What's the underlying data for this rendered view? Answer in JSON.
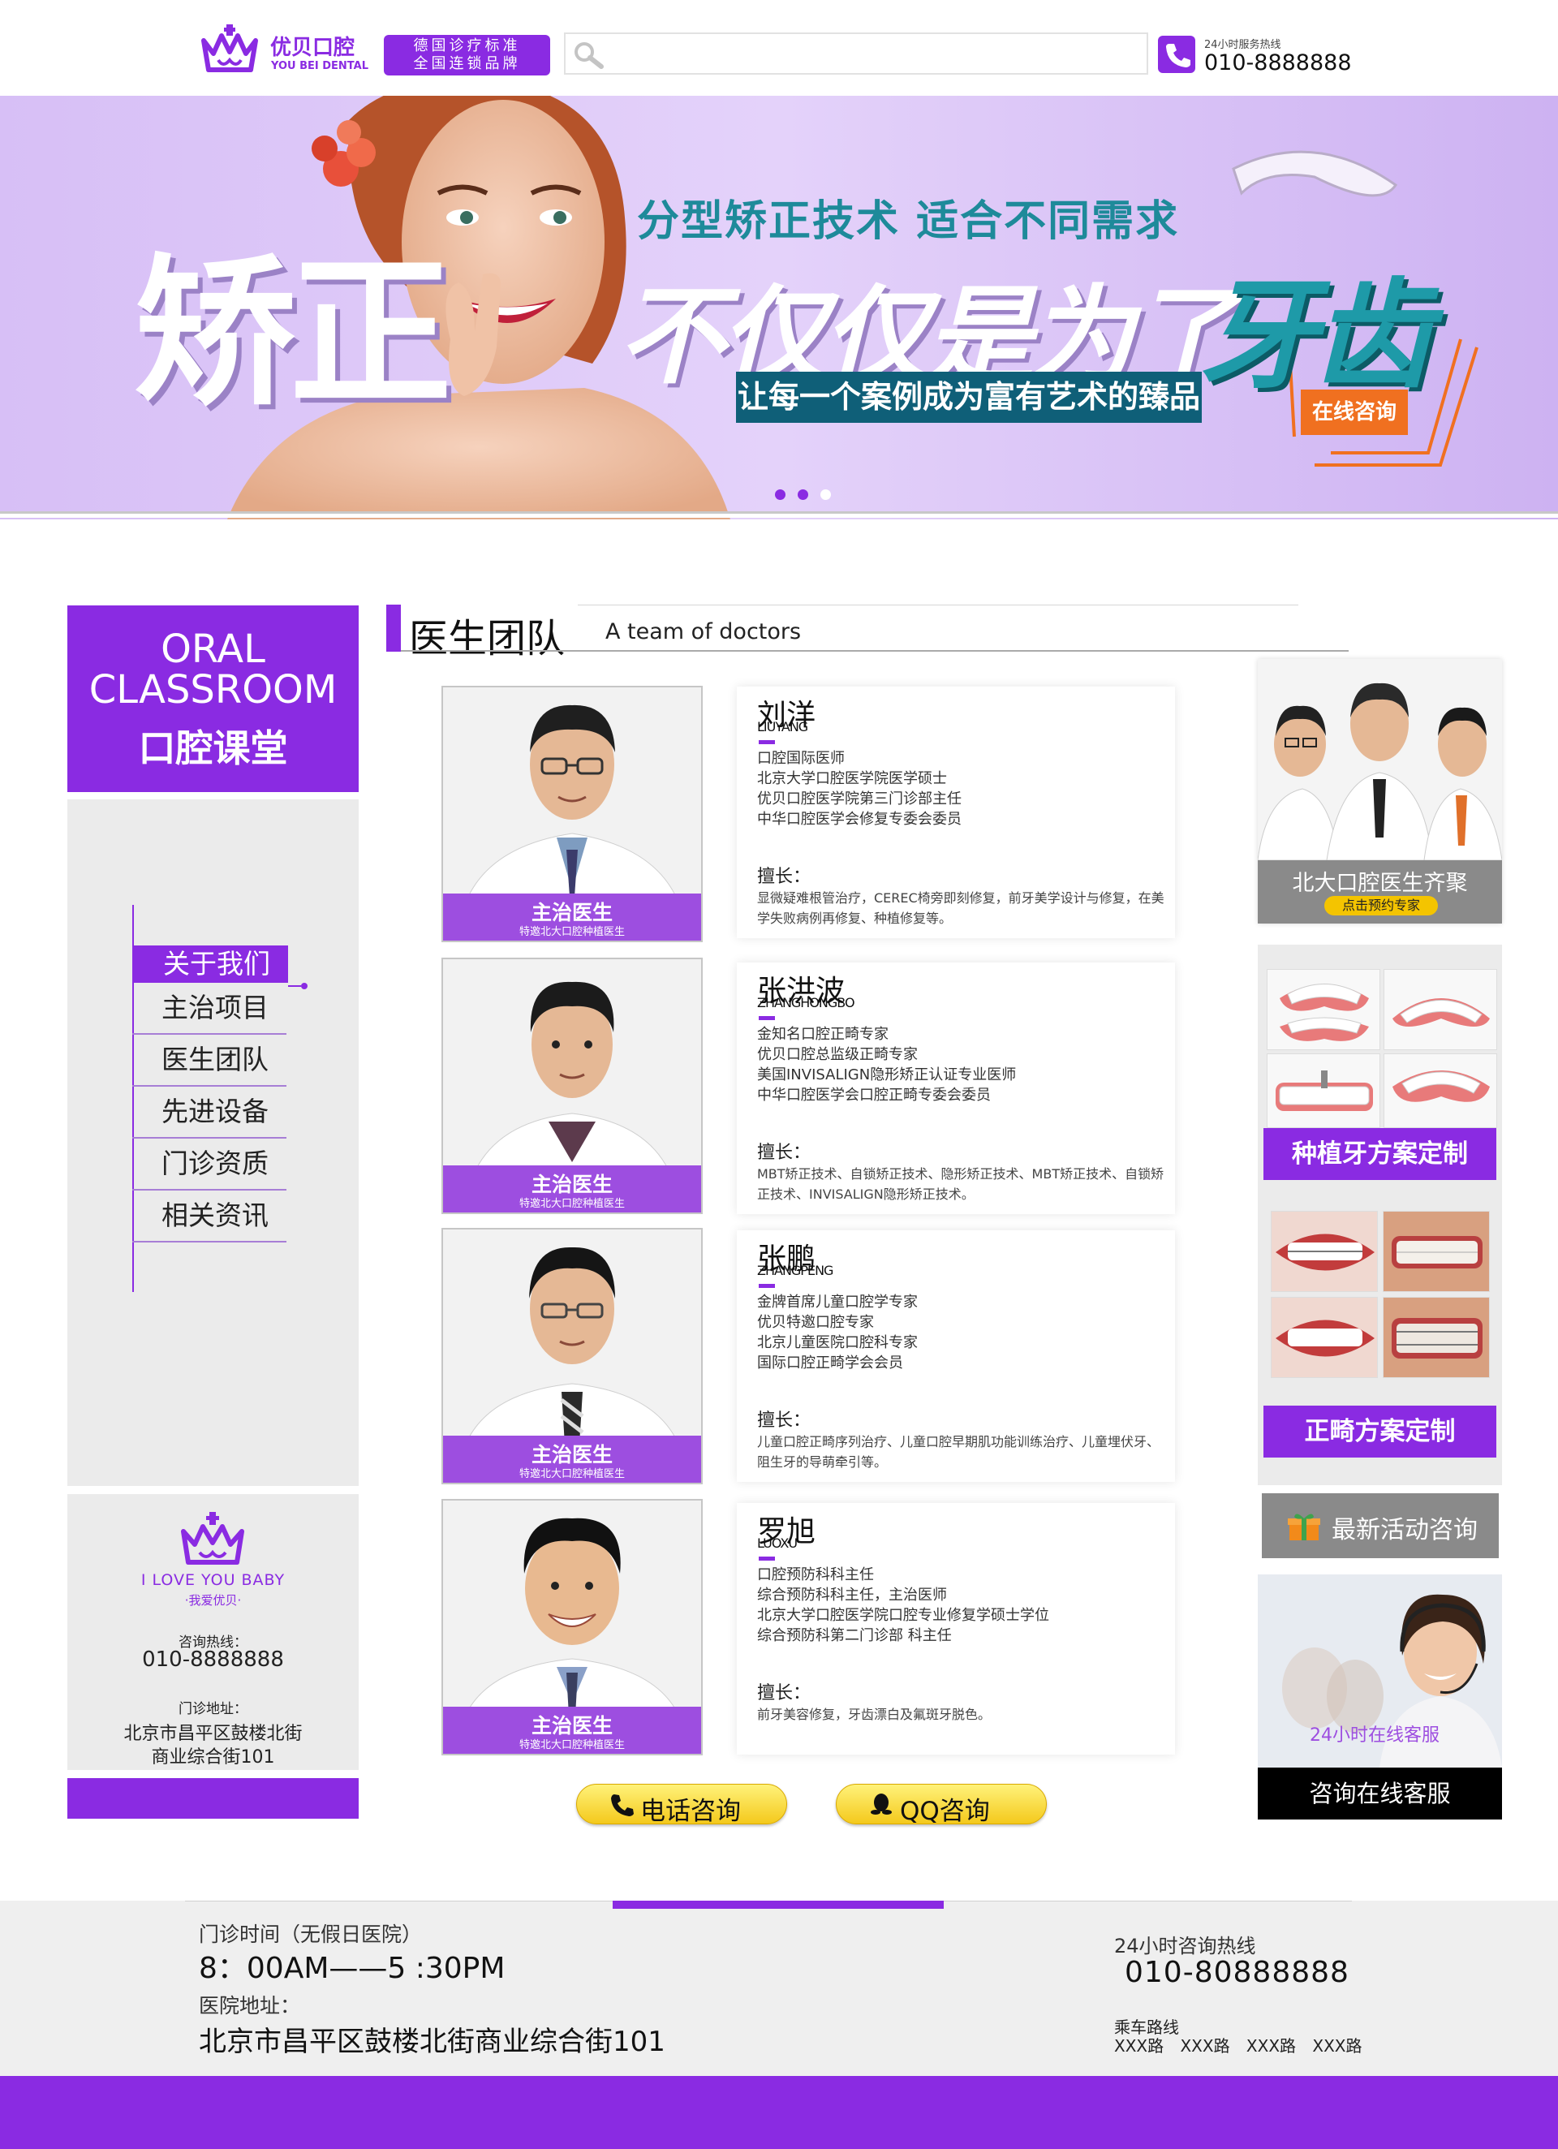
{
  "header": {
    "logo_cn": "优贝口腔",
    "logo_en": "YOU BEI DENTAL",
    "slogan_line1": "德国诊疗标准",
    "slogan_line2": "全国连锁品牌",
    "search_placeholder": "",
    "hotline_label": "24小时服务热线",
    "hotline_number": "010-8888888"
  },
  "banner": {
    "headline_left": "矫正",
    "subtitle": "分型矫正技术  适合不同需求",
    "headline_right": "不仅仅是为了",
    "headline_accent": "牙齿",
    "tagline": "让每一个案例成为富有艺术的臻品",
    "consult_button": "在线咨询",
    "slide_count": 3,
    "active_slide": 3
  },
  "sidebar": {
    "classroom_en_1": "ORAL",
    "classroom_en_2": "CLASSROOM",
    "classroom_cn": "口腔课堂",
    "nav": [
      {
        "label": "关于我们",
        "active": true
      },
      {
        "label": "主治项目",
        "active": false
      },
      {
        "label": "医生团队",
        "active": false
      },
      {
        "label": "先进设备",
        "active": false
      },
      {
        "label": "门诊资质",
        "active": false
      },
      {
        "label": "相关资讯",
        "active": false
      }
    ],
    "contact": {
      "love": "I LOVE YOU BABY",
      "love_cn": "·我爱优贝·",
      "hotline_label": "咨询热线：",
      "hotline": "010-8888888",
      "address_label": "门诊地址：",
      "address_line1": "北京市昌平区鼓楼北街",
      "address_line2": "商业综合街101"
    }
  },
  "section": {
    "title_cn": "医生团队",
    "title_en": "A team of doctors"
  },
  "doctors": [
    {
      "name": "刘洋",
      "pinyin": "LIUYANG",
      "caption": "主治医生",
      "caption_sub": "特邀北大口腔种植医生",
      "lines": [
        "口腔国际医师",
        "北京大学口腔医学院医学硕士",
        "优贝口腔医学院第三门诊部主任",
        "中华口腔医学会修复专委会委员"
      ],
      "skill_label": "擅长：",
      "skill": "显微疑难根管治疗，CEREC椅旁即刻修复，前牙美学设计与修复，在美学失败病例再修复、种植修复等。"
    },
    {
      "name": "张洪波",
      "pinyin": "ZHANGHONGBO",
      "caption": "主治医生",
      "caption_sub": "特邀北大口腔种植医生",
      "lines": [
        "金知名口腔正畸专家",
        "优贝口腔总监级正畸专家",
        "美国INVISALIGN隐形矫正认证专业医师",
        "中华口腔医学会口腔正畸专委会委员"
      ],
      "skill_label": "擅长：",
      "skill": "MBT矫正技术、自锁矫正技术、隐形矫正技术、MBT矫正技术、自锁矫正技术、INVISALIGN隐形矫正技术。"
    },
    {
      "name": "张鹏",
      "pinyin": "ZHANGPENG",
      "caption": "主治医生",
      "caption_sub": "特邀北大口腔种植医生",
      "lines": [
        "金牌首席儿童口腔学专家",
        "优贝特邀口腔专家",
        "北京儿童医院口腔科专家",
        "国际口腔正畸学会会员"
      ],
      "skill_label": "擅长：",
      "skill": "儿童口腔正畸序列治疗、儿童口腔早期肌功能训练治疗、儿童埋伏牙、阻生牙的导萌牵引等。"
    },
    {
      "name": "罗旭",
      "pinyin": "LUOXU",
      "caption": "主治医生",
      "caption_sub": "特邀北大口腔种植医生",
      "lines": [
        "口腔预防科科主任",
        "综合预防科科主任，主治医师",
        "北京大学口腔医学院口腔专业修复学硕士学位",
        "综合预防科第二门诊部 科主任"
      ],
      "skill_label": "擅长：",
      "skill": "前牙美容修复，牙齿漂白及氟斑牙脱色。"
    }
  ],
  "buttons": {
    "call": "电话咨询",
    "qq": "QQ咨询"
  },
  "right": {
    "group_title": "北大口腔医生齐聚",
    "group_button": "点击预约专家",
    "implant": "种植牙方案定制",
    "ortho": "正畸方案定制",
    "news": "最新活动咨询",
    "service_overlay": "24小时在线客服",
    "service_caption": "咨询在线客服"
  },
  "footer": {
    "hours_label": "门诊时间（无假日医院）",
    "hours": "8：00AM——5 :30PM",
    "address_label": "医院地址：",
    "address": "北京市昌平区鼓楼北街商业综合街101",
    "hotline_label": "24小时咨询热线",
    "hotline": "010-80888888",
    "route_label": "乘车路线",
    "routes": "XXX路 XXX路 XXX路 XXX路"
  },
  "colors": {
    "brand_purple": "#8a2be2",
    "banner_bg": "#dcc4f7",
    "teal": "#1e8a9a",
    "consult_orange": "#f07020",
    "button_yellow": "#f4c91c"
  }
}
